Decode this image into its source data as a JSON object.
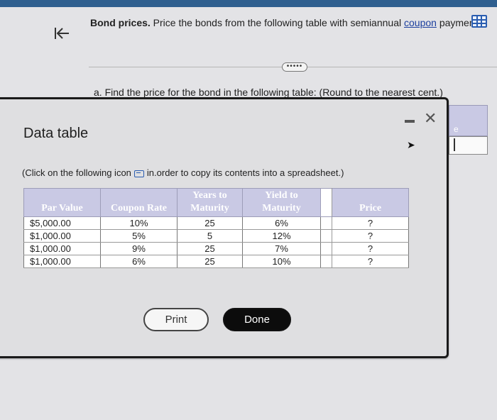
{
  "question": {
    "title_bold": "Bond prices.",
    "text_before_link": " Price the bonds from the following table with semiannual ",
    "link_text": "coupon",
    "text_after_link": " payments:"
  },
  "icons": {
    "back": "back-to-start-icon",
    "grid": "spreadsheet-grid-icon",
    "more": "more-dots-icon",
    "minimize": "minimize-icon",
    "close": "close-icon",
    "copy": "copy-icon",
    "cursor": "mouse-cursor-icon"
  },
  "more_label": "•••••",
  "part_a": "a. Find the price for the bond in the following table: (Round to the nearest cent.)",
  "right_panel_char": "e",
  "modal": {
    "title": "Data table",
    "copy_note_before": "(Click on the following icon",
    "copy_note_after": "in.order to copy its contents into a spreadsheet.)",
    "columns": [
      "Par Value",
      "Coupon Rate",
      "Years to Maturity",
      "Yield to Maturity",
      "Price"
    ],
    "rows": [
      {
        "par": "$5,000.00",
        "coupon": "10%",
        "years": "25",
        "yield": "6%",
        "price": "?"
      },
      {
        "par": "$1,000.00",
        "coupon": "5%",
        "years": "5",
        "yield": "12%",
        "price": "?"
      },
      {
        "par": "$1,000.00",
        "coupon": "9%",
        "years": "25",
        "yield": "7%",
        "price": "?"
      },
      {
        "par": "$1,000.00",
        "coupon": "6%",
        "years": "25",
        "yield": "10%",
        "price": "?"
      }
    ],
    "print_label": "Print",
    "done_label": "Done"
  },
  "colors": {
    "header_fill": "#c9c9e4",
    "done_button": "#0c0c0c",
    "link": "#1c3f9e"
  }
}
